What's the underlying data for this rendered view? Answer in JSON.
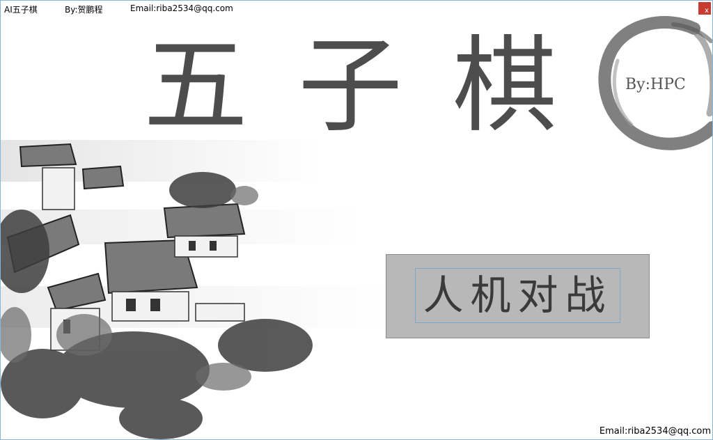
{
  "window": {
    "app_title": "AI五子棋",
    "author": "By:贺鹏程",
    "email": "Email:riba2534@qq.com",
    "close_label": "x"
  },
  "hero": {
    "title": "五子棋",
    "byline": "By:HPC"
  },
  "menu": {
    "pve_button_label": "人机对战"
  },
  "footer": {
    "email": "Email:riba2534@qq.com"
  },
  "colors": {
    "title_text": "#4d4d4d",
    "button_bg": "#b8b8b8",
    "close_bg": "#c73b30",
    "ink": "#3a3a3a"
  },
  "icons": {
    "close": "close-icon",
    "ink_circle": "ink-brush-circle",
    "painting": "ink-village-painting"
  }
}
